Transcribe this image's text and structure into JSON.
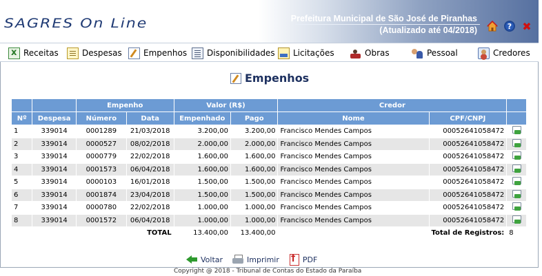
{
  "header": {
    "logo": "SAGRES On Line",
    "org_name": "Prefeitura Municipal de São José de Piranhas",
    "updated": "(Atualizado até 04/2018)",
    "icons": [
      "home-icon",
      "help-icon",
      "close-icon"
    ],
    "help_glyph": "?",
    "close_glyph": "✖"
  },
  "menu": [
    {
      "label": "Receitas",
      "icon": "spreadsheet-icon"
    },
    {
      "label": "Despesas",
      "icon": "document-icon"
    },
    {
      "label": "Empenhos",
      "icon": "pencil-document-icon"
    },
    {
      "label": "Disponibilidades",
      "icon": "list-document-icon"
    },
    {
      "label": "Licitações",
      "icon": "folder-icon"
    },
    {
      "label": "Obras",
      "icon": "worker-icon"
    },
    {
      "label": "Pessoal",
      "icon": "people-icon"
    },
    {
      "label": "Credores",
      "icon": "person-card-icon"
    }
  ],
  "page_title": "Empenhos",
  "table": {
    "group_headers": {
      "empenho": "Empenho",
      "valor": "Valor (R$)",
      "credor": "Credor"
    },
    "columns": {
      "n": "Nº",
      "despesa": "Despesa",
      "numero": "Número",
      "data": "Data",
      "empenhado": "Empenhado",
      "pago": "Pago",
      "nome": "Nome",
      "cpf": "CPF/CNPJ"
    },
    "rows": [
      {
        "n": "1",
        "despesa": "339014",
        "numero": "0001289",
        "data": "21/03/2018",
        "empenhado": "3.200,00",
        "pago": "3.200,00",
        "nome": "Francisco Mendes Campos",
        "cpf": "00052641058472"
      },
      {
        "n": "2",
        "despesa": "339014",
        "numero": "0000527",
        "data": "08/02/2018",
        "empenhado": "2.000,00",
        "pago": "2.000,00",
        "nome": "Francisco Mendes Campos",
        "cpf": "00052641058472"
      },
      {
        "n": "3",
        "despesa": "339014",
        "numero": "0000779",
        "data": "22/02/2018",
        "empenhado": "1.600,00",
        "pago": "1.600,00",
        "nome": "Francisco Mendes Campos",
        "cpf": "00052641058472"
      },
      {
        "n": "4",
        "despesa": "339014",
        "numero": "0001573",
        "data": "06/04/2018",
        "empenhado": "1.600,00",
        "pago": "1.600,00",
        "nome": "Francisco Mendes Campos",
        "cpf": "00052641058472"
      },
      {
        "n": "5",
        "despesa": "339014",
        "numero": "0000103",
        "data": "16/01/2018",
        "empenhado": "1.500,00",
        "pago": "1.500,00",
        "nome": "Francisco Mendes Campos",
        "cpf": "00052641058472"
      },
      {
        "n": "6",
        "despesa": "339014",
        "numero": "0001874",
        "data": "23/04/2018",
        "empenhado": "1.500,00",
        "pago": "1.500,00",
        "nome": "Francisco Mendes Campos",
        "cpf": "00052641058472"
      },
      {
        "n": "7",
        "despesa": "339014",
        "numero": "0000780",
        "data": "22/02/2018",
        "empenhado": "1.000,00",
        "pago": "1.000,00",
        "nome": "Francisco Mendes Campos",
        "cpf": "00052641058472"
      },
      {
        "n": "8",
        "despesa": "339014",
        "numero": "0001572",
        "data": "06/04/2018",
        "empenhado": "1.000,00",
        "pago": "1.000,00",
        "nome": "Francisco Mendes Campos",
        "cpf": "00052641058472"
      }
    ],
    "total_label": "TOTAL",
    "total_empenhado": "13.400,00",
    "total_pago": "13.400,00",
    "total_registros_label": "Total de Registros:",
    "total_registros": "8"
  },
  "actions": {
    "back": "Voltar",
    "print": "Imprimir",
    "pdf": "PDF"
  },
  "footer": {
    "copyright": "Copyright @ 2018 - Tribunal de Contas do Estado da Paraíba"
  }
}
